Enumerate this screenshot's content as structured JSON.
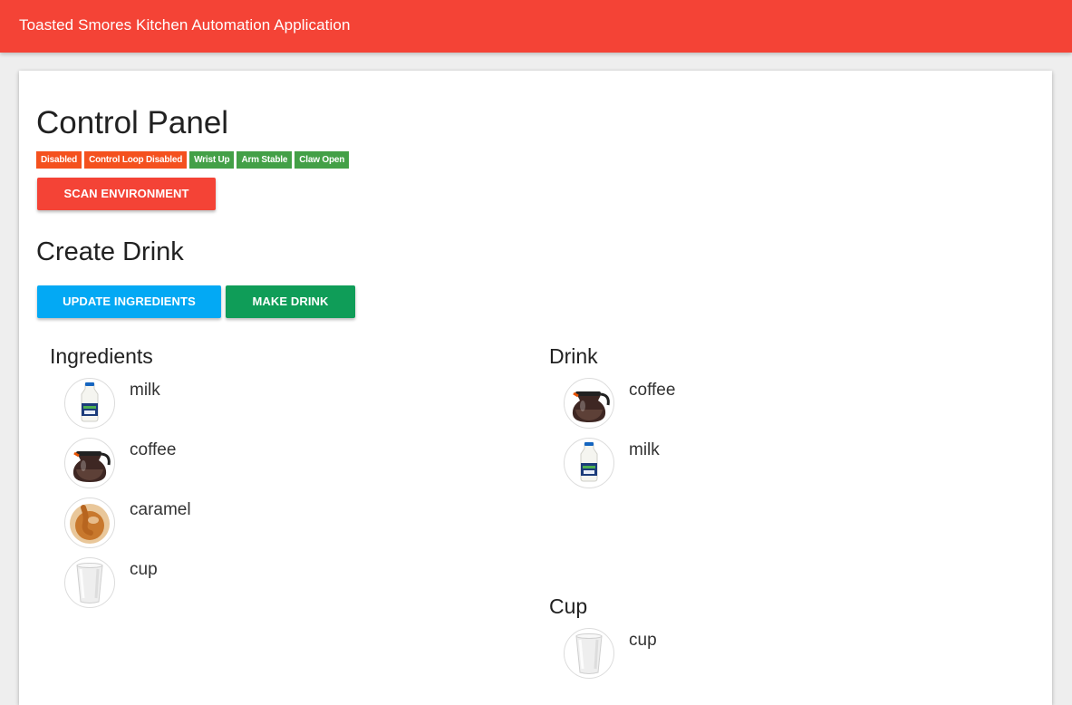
{
  "app": {
    "title": "Toasted Smores Kitchen Automation Application"
  },
  "control_panel": {
    "title": "Control Panel",
    "badges": [
      {
        "label": "Disabled",
        "color": "#f4511e"
      },
      {
        "label": "Control Loop Disabled",
        "color": "#f4511e"
      },
      {
        "label": "Wrist Up",
        "color": "#43a047"
      },
      {
        "label": "Arm Stable",
        "color": "#43a047"
      },
      {
        "label": "Claw Open",
        "color": "#43a047"
      }
    ],
    "scan_button": "SCAN ENVIRONMENT"
  },
  "create_drink": {
    "title": "Create Drink",
    "update_button": "UPDATE INGREDIENTS",
    "make_button": "MAKE DRINK"
  },
  "ingredients": {
    "title": "Ingredients",
    "items": [
      {
        "label": "milk",
        "icon": "milk-jug-icon"
      },
      {
        "label": "coffee",
        "icon": "coffee-pot-icon"
      },
      {
        "label": "caramel",
        "icon": "caramel-icon"
      },
      {
        "label": "cup",
        "icon": "cup-icon"
      }
    ]
  },
  "drink": {
    "title": "Drink",
    "items": [
      {
        "label": "coffee",
        "icon": "coffee-pot-icon"
      },
      {
        "label": "milk",
        "icon": "milk-jug-icon"
      }
    ]
  },
  "cup": {
    "title": "Cup",
    "items": [
      {
        "label": "cup",
        "icon": "cup-icon"
      }
    ]
  },
  "colors": {
    "appbar": "#f44336",
    "scan": "#f44336",
    "update": "#03a9f4",
    "make": "#0f9d58"
  }
}
